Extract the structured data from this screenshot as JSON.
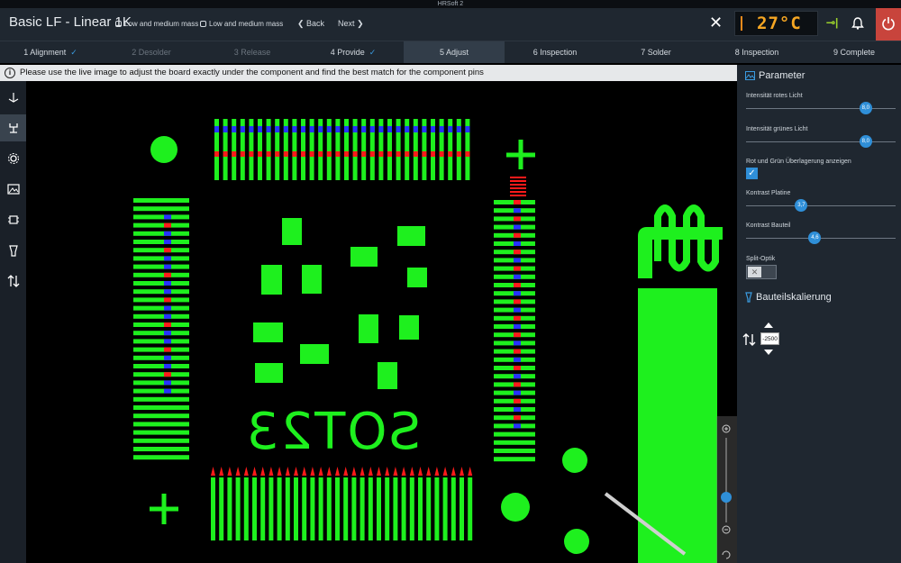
{
  "window_title": "HRSoft 2",
  "header": {
    "app_title": "Basic LF - Linear 1K",
    "mass_1": "Low and medium mass",
    "mass_2": "Low and medium mass",
    "back_label": "Back",
    "next_label": "Next",
    "temperature": "27°C"
  },
  "steps": [
    {
      "label": "1 Alignment",
      "state": "done"
    },
    {
      "label": "2 Desolder",
      "state": "disabled"
    },
    {
      "label": "3 Release",
      "state": "disabled"
    },
    {
      "label": "4 Provide",
      "state": "done"
    },
    {
      "label": "5 Adjust",
      "state": "active"
    },
    {
      "label": "6 Inspection",
      "state": "normal"
    },
    {
      "label": "7 Solder",
      "state": "normal"
    },
    {
      "label": "8 Inspection",
      "state": "normal"
    },
    {
      "label": "9 Complete",
      "state": "normal"
    }
  ],
  "info": "Please use the live image to adjust the board exactly under the component and find the best match for the component pins",
  "tools": [
    "crosshair-icon",
    "component-icon",
    "gear-icon",
    "image-icon",
    "chip-icon",
    "nozzle-icon",
    "swap-icon"
  ],
  "component_label": "SOT23",
  "panel": {
    "title": "Parameter",
    "red_label": "Intensität rotes Licht",
    "red_value": 8.0,
    "red_text": "8,0",
    "green_label": "Intensität grünes Licht",
    "green_value": 8.0,
    "green_text": "8,0",
    "overlay_label": "Rot und Grün Überlagerung anzeigen",
    "overlay_checked": true,
    "board_contrast_label": "Kontrast Platine",
    "board_contrast_value": 3.7,
    "board_contrast_text": "3,7",
    "comp_contrast_label": "Kontrast Bauteil",
    "comp_contrast_value": 4.6,
    "comp_contrast_text": "4,6",
    "split_label": "Split-Optik",
    "split_on": false,
    "scaling_title": "Bauteilskalierung",
    "scaling_value": "-2500"
  },
  "colors": {
    "accent": "#2f8fd8",
    "power": "#c8443c",
    "pcb_green": "#1ef01e",
    "pin_red": "#ff1a1a",
    "pin_blue": "#2633ff",
    "temp": "#f5a623"
  }
}
